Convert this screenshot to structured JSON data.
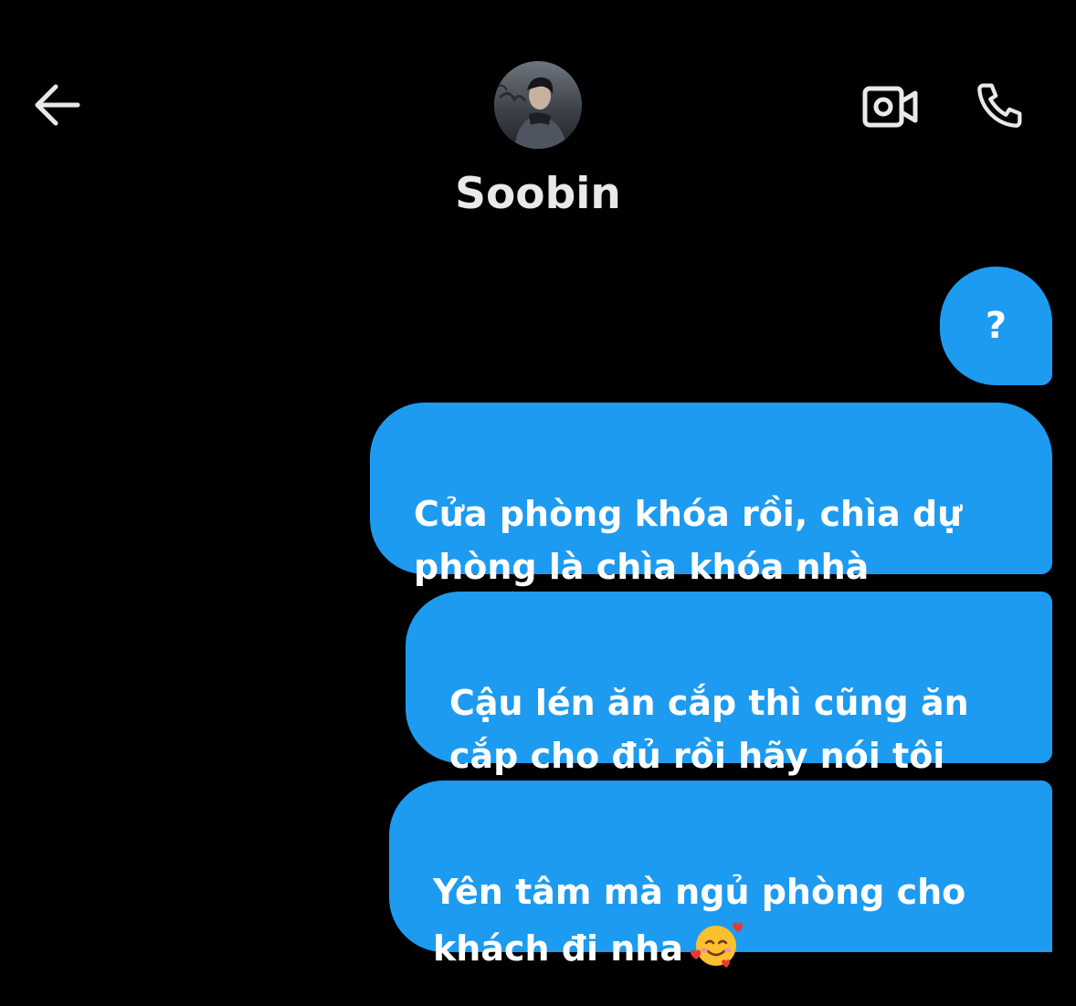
{
  "header": {
    "back_icon": "arrow-left-icon",
    "video_icon": "video-camera-icon",
    "call_icon": "phone-icon",
    "contact_name": "Soobin",
    "avatar": "contact-avatar-photo"
  },
  "messages": [
    {
      "text": "?"
    },
    {
      "text": "Cửa phòng khóa rồi, chìa dự\nphòng là chìa khóa nhà"
    },
    {
      "text": "Cậu lén ăn cắp thì cũng ăn\ncắp cho đủ rồi hãy nói tôi"
    },
    {
      "text": "Yên tâm mà ngủ phòng cho\nkhách đi nha",
      "emoji": "smiling-face-with-hearts"
    }
  ],
  "colors": {
    "background": "#000000",
    "bubble": "#1d9bf0",
    "bubble_text": "#ffffff",
    "name_text": "#e7e9ea"
  }
}
